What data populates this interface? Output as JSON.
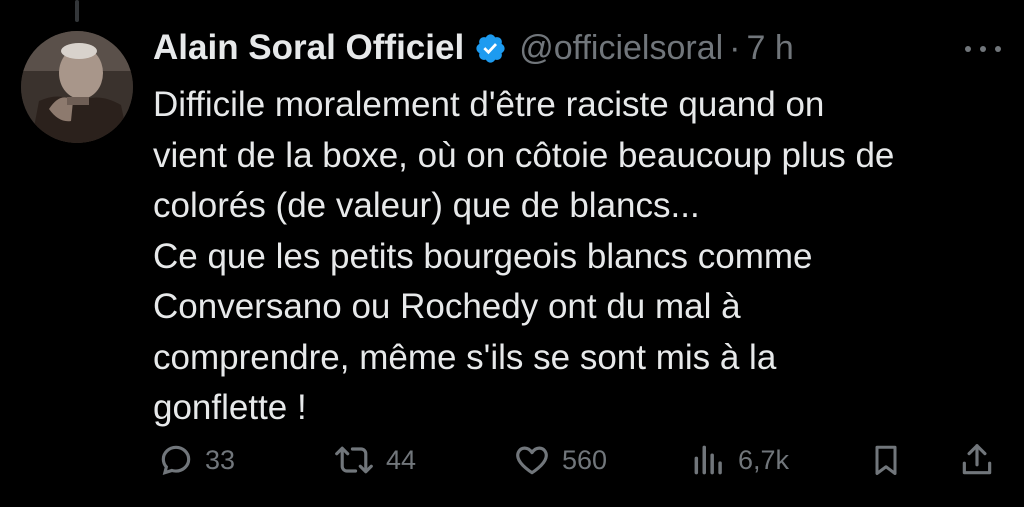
{
  "tweet": {
    "display_name": "Alain Soral Officiel",
    "handle": "@officielsoral",
    "separator": "·",
    "time": "7 h",
    "text": "Difficile moralement d'être raciste quand on\nvient de la boxe, où on côtoie beaucoup plus de\ncolorés (de valeur) que de blancs...\nCe que les petits bourgeois blancs comme\nConversano ou Rochedy ont du mal à\ncomprendre, même s'ils se sont mis à la\ngonflette !"
  },
  "actions": {
    "replies": "33",
    "reposts": "44",
    "likes": "560",
    "views": "6,7k"
  },
  "icons": {
    "verified": "verified-badge-icon",
    "more": "more-icon",
    "reply": "reply-icon",
    "repost": "repost-icon",
    "like": "heart-icon",
    "views": "views-icon",
    "bookmark": "bookmark-icon",
    "share": "share-icon"
  },
  "colors": {
    "background": "#000000",
    "text": "#e7e9ea",
    "muted": "#71767b",
    "verified": "#1d9bf0"
  }
}
